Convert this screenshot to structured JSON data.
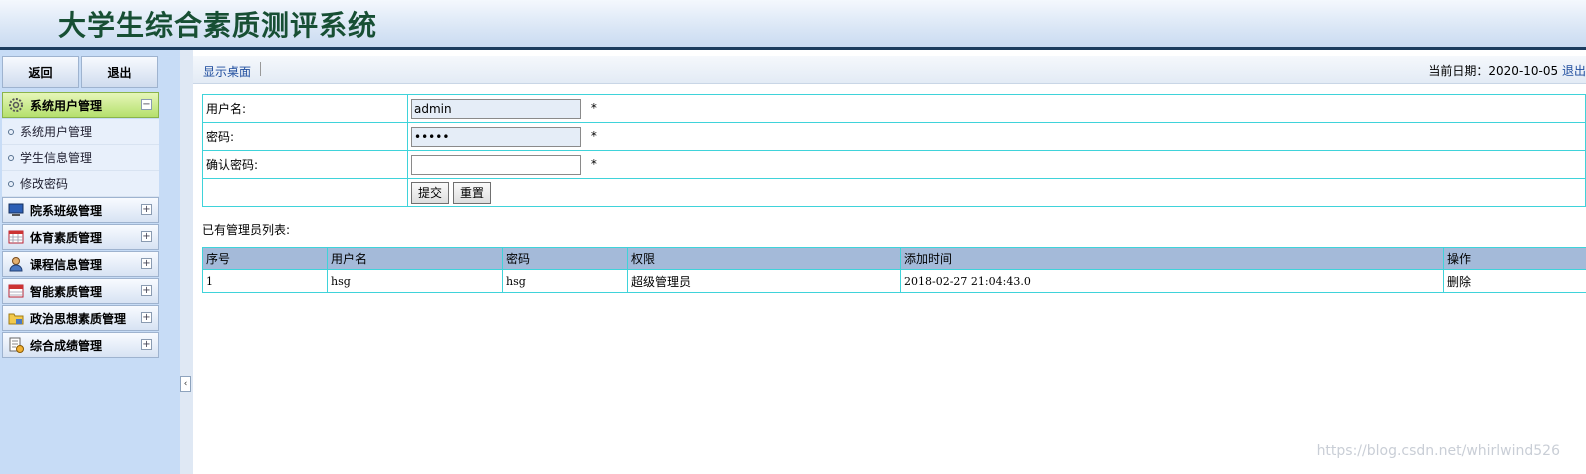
{
  "app": {
    "title": "大学生综合素质测评系统"
  },
  "sidebar": {
    "back_label": "返回",
    "exit_label": "退出",
    "menus": [
      {
        "label": "系统用户管理",
        "icon": "gear-icon",
        "expanded": true,
        "items": [
          {
            "label": "系统用户管理"
          },
          {
            "label": "学生信息管理"
          },
          {
            "label": "修改密码"
          }
        ]
      },
      {
        "label": "院系班级管理",
        "icon": "monitor-icon",
        "expanded": false
      },
      {
        "label": "体育素质管理",
        "icon": "calendar-icon",
        "expanded": false
      },
      {
        "label": "课程信息管理",
        "icon": "user-icon",
        "expanded": false
      },
      {
        "label": "智能素质管理",
        "icon": "calendar-icon",
        "expanded": false
      },
      {
        "label": "政治思想素质管理",
        "icon": "folder-icon",
        "expanded": false
      },
      {
        "label": "综合成绩管理",
        "icon": "report-icon",
        "expanded": false
      }
    ],
    "collapse_glyph": "‹"
  },
  "toolbar": {
    "desk_label": "显示桌面",
    "date_label": "当前日期：2020-10-05",
    "logout_label": "退出"
  },
  "form": {
    "username_label": "用户名:",
    "username_value": "admin",
    "password_label": "密码:",
    "password_value": "•••••",
    "confirm_label": "确认密码:",
    "confirm_value": "",
    "required_mark": "*",
    "submit_label": "提交",
    "reset_label": "重置"
  },
  "list": {
    "title": "已有管理员列表:",
    "headers": [
      "序号",
      "用户名",
      "密码",
      "权限",
      "添加时间",
      "操作"
    ],
    "rows": [
      {
        "index": "1",
        "username": "hsg",
        "password": "hsg",
        "role": "超级管理员",
        "added": "2018-02-27 21:04:43.0",
        "action": "删除"
      }
    ]
  },
  "watermark": "https://blog.csdn.net/whirlwind526",
  "colors": {
    "header_text": "#174f34",
    "table_border": "#3fd3da",
    "table_header": "#a4bad9",
    "sidebar_bg": "#c7dcf6",
    "active_menu": "#b5e06d",
    "link": "#1f4d9e"
  }
}
